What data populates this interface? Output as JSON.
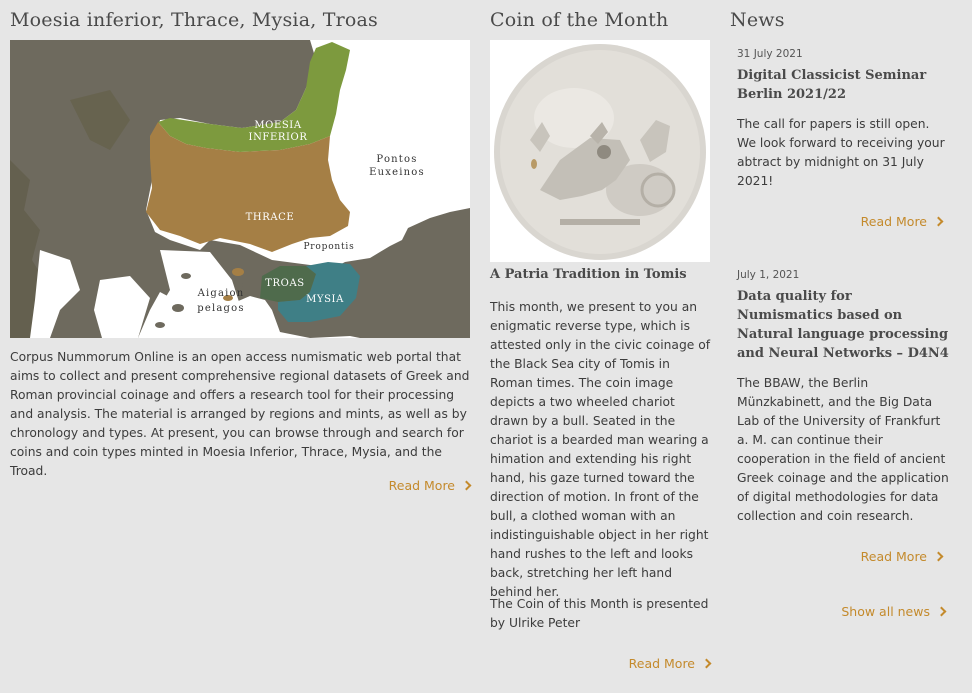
{
  "regions": {
    "title": "Moesia inferior, Thrace, Mysia, Troas",
    "map_labels": {
      "moesia": [
        "MOESIA",
        "INFERIOR"
      ],
      "thrace": "THRACE",
      "pontos": [
        "Pontos",
        "Euxeinos"
      ],
      "propontis": "Propontis",
      "troas": "TROAS",
      "mysia": "MYSIA",
      "aigaion": [
        "Aigaion",
        "pelagos"
      ]
    },
    "description": "Corpus Nummorum Online is an open access numismatic web portal that aims to collect and present comprehensive regional datasets of Greek and Roman provincial coinage and offers a research tool for their processing and analysis. The material is arranged by regions and mints, as well as by chronology and types. At present, you can browse through and search for coins and coin types minted in Moesia Inferior, Thrace, Mysia, and the Troad.",
    "read_more": "Read More"
  },
  "coin": {
    "title": "Coin of the Month",
    "heading": "A Patria Tradition in Tomis",
    "text": "This month, we present to you an enigmatic reverse type, which is attested only in the civic coinage of the Black Sea city of Tomis in Roman times. The coin image depicts a two wheeled chariot drawn by a bull. Seated in the chariot is a bearded man wearing a himation and extending his right hand, his gaze turned toward the direction of motion. In front of the bull, a clothed woman with an indistinguishable object in her right hand rushes to the left and looks back, stretching her left hand behind her.",
    "credit": "The Coin of this Month is presented by Ulrike Peter",
    "read_more": "Read More"
  },
  "news": {
    "title": "News",
    "items": [
      {
        "date": "31 July 2021",
        "title": "Digital Classicist Seminar Berlin 2021/22",
        "text": "The call for papers is still open. We look forward to receiving your abtract by midnight on 31 July 2021!",
        "read_more": "Read More"
      },
      {
        "date": "July 1, 2021",
        "title": "Data quality for Numismatics based on Natural language processing and Neural Networks – D4N4",
        "text": "The BBAW, the Berlin Münzkabinett, and the Big Data Lab of the University of Frankfurt a. M. can continue their cooperation in the field of ancient Greek coinage and the application of digital methodologies for data collection and coin research.",
        "read_more": "Read More"
      }
    ],
    "show_all": "Show all news"
  },
  "colors": {
    "accent": "#c48a2c",
    "background": "#e6e6e6",
    "land": "#6e6a5e",
    "moesia": "#7d9a3e",
    "thrace": "#a57f45",
    "troas": "#4f6b4c",
    "mysia": "#3f7f86"
  }
}
